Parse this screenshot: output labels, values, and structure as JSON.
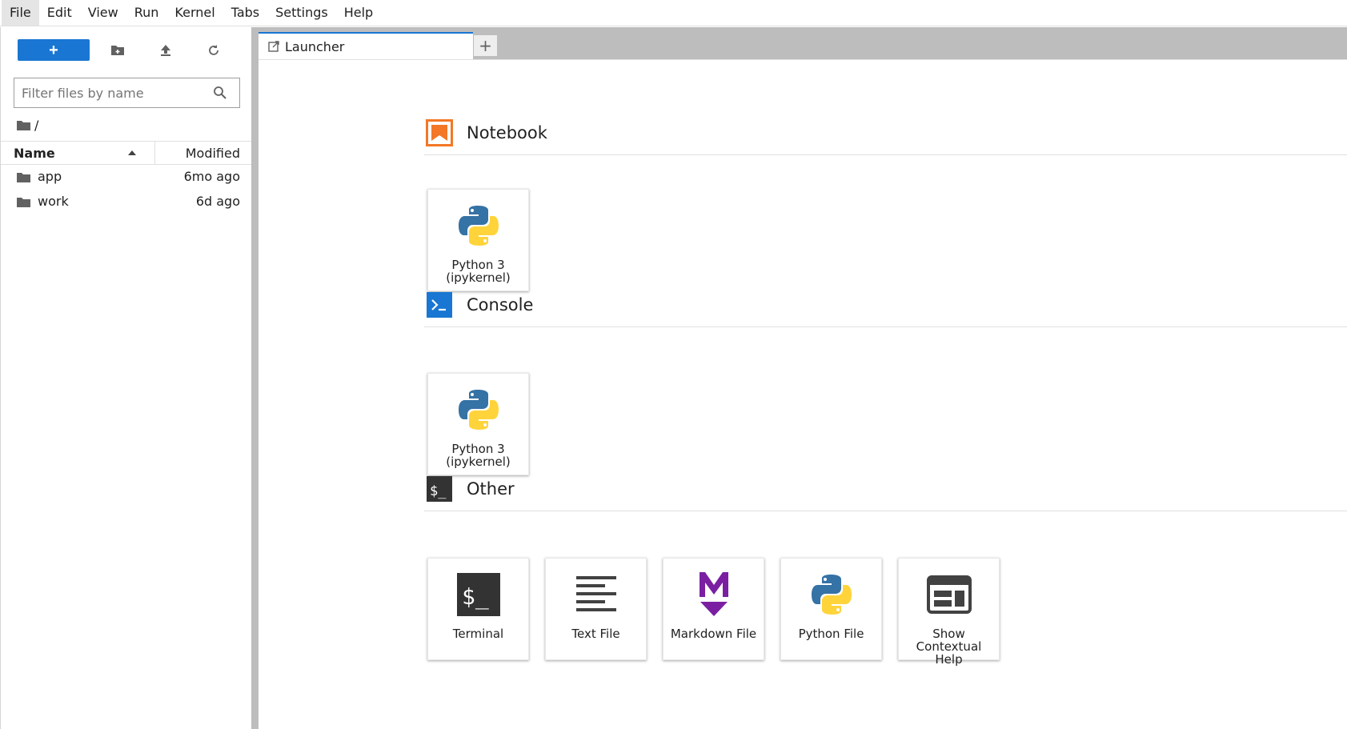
{
  "menubar": {
    "items": [
      "File",
      "Edit",
      "View",
      "Run",
      "Kernel",
      "Tabs",
      "Settings",
      "Help"
    ]
  },
  "sidebar": {
    "new_label": "+",
    "filter_placeholder": "Filter files by name",
    "breadcrumb": "/",
    "columns": {
      "name": "Name",
      "modified": "Modified"
    },
    "files": [
      {
        "name": "app",
        "modified": "6mo ago"
      },
      {
        "name": "work",
        "modified": "6d ago"
      }
    ]
  },
  "tabs": {
    "active_label": "Launcher",
    "add_label": "+"
  },
  "launcher": {
    "sections": [
      {
        "title": "Notebook",
        "cards": [
          {
            "label_line1": "Python 3",
            "label_line2": "(ipykernel)"
          }
        ]
      },
      {
        "title": "Console",
        "cards": [
          {
            "label_line1": "Python 3",
            "label_line2": "(ipykernel)"
          }
        ]
      },
      {
        "title": "Other",
        "cards": [
          {
            "label": "Terminal"
          },
          {
            "label": "Text File"
          },
          {
            "label": "Markdown File"
          },
          {
            "label": "Python File"
          },
          {
            "label_line1": "Show",
            "label_line2": "Contextual",
            "label_line3": "Help"
          }
        ]
      }
    ]
  },
  "colors": {
    "accent": "#1976d2",
    "notebook_orange": "#f37726",
    "markdown_purple": "#7b1fa2",
    "terminal_dark": "#333333"
  }
}
